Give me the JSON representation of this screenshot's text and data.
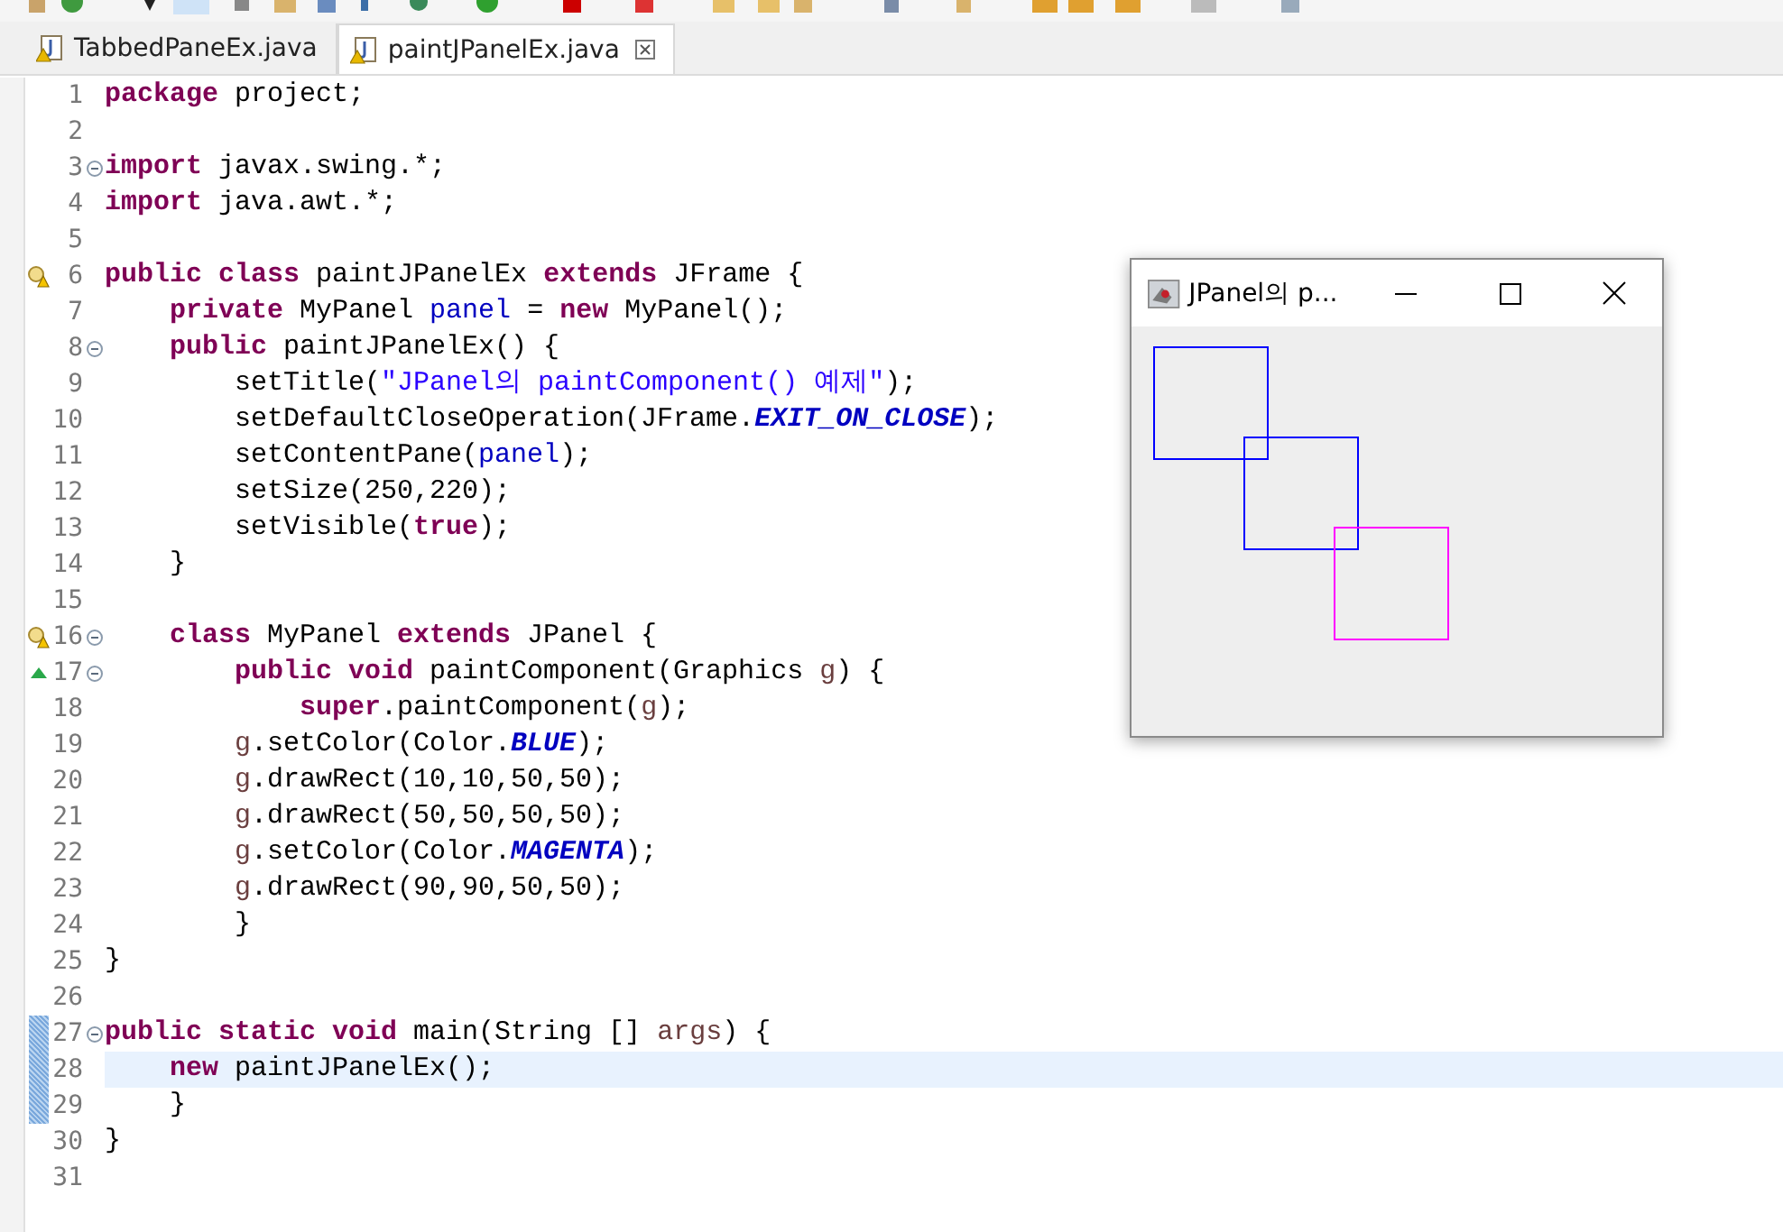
{
  "tabs": [
    {
      "label": "TabbedPaneEx.java",
      "selected": false
    },
    {
      "label": "paintJPanelEx.java",
      "selected": true
    }
  ],
  "editor": {
    "lines": [
      {
        "number": "1",
        "warning": false,
        "override": false,
        "fold": false,
        "changed": false,
        "current": false,
        "tokens": [
          {
            "kind": "kw",
            "text": "package"
          },
          {
            "kind": "plain",
            "text": " project;"
          }
        ]
      },
      {
        "number": "2",
        "warning": false,
        "override": false,
        "fold": false,
        "changed": false,
        "current": false
      },
      {
        "number": "3",
        "warning": false,
        "override": false,
        "fold": true,
        "changed": false,
        "current": false,
        "tokens": [
          {
            "kind": "kw",
            "text": "import"
          },
          {
            "kind": "plain",
            "text": " javax.swing.*;"
          }
        ]
      },
      {
        "number": "4",
        "warning": false,
        "override": false,
        "fold": false,
        "changed": false,
        "current": false,
        "tokens": [
          {
            "kind": "kw",
            "text": "import"
          },
          {
            "kind": "plain",
            "text": " java.awt.*;"
          }
        ]
      },
      {
        "number": "5",
        "warning": false,
        "override": false,
        "fold": false,
        "changed": false,
        "current": false
      },
      {
        "number": "6",
        "warning": true,
        "override": false,
        "fold": false,
        "changed": false,
        "current": false,
        "tokens": [
          {
            "kind": "kw",
            "text": "public class"
          },
          {
            "kind": "plain",
            "text": " paintJPanelEx "
          },
          {
            "kind": "kw",
            "text": "extends"
          },
          {
            "kind": "plain",
            "text": " JFrame {"
          }
        ]
      },
      {
        "number": "7",
        "warning": false,
        "override": false,
        "fold": false,
        "changed": false,
        "current": false,
        "tokens": [
          {
            "kind": "kw",
            "text": "    private"
          },
          {
            "kind": "plain",
            "text": " MyPanel "
          },
          {
            "kind": "field",
            "text": "panel"
          },
          {
            "kind": "plain",
            "text": " = "
          },
          {
            "kind": "kw",
            "text": "new"
          },
          {
            "kind": "plain",
            "text": " MyPanel();"
          }
        ]
      },
      {
        "number": "8",
        "warning": false,
        "override": false,
        "fold": true,
        "changed": false,
        "current": false,
        "tokens": [
          {
            "kind": "kw",
            "text": "    public"
          },
          {
            "kind": "plain",
            "text": " paintJPanelEx() {"
          }
        ]
      },
      {
        "number": "9",
        "warning": false,
        "override": false,
        "fold": false,
        "changed": false,
        "current": false,
        "tokens": [
          {
            "kind": "plain",
            "text": "        setTitle("
          },
          {
            "kind": "str",
            "text": "\"JPanel의 paintComponent() 예제\""
          },
          {
            "kind": "plain",
            "text": ");"
          }
        ]
      },
      {
        "number": "10",
        "warning": false,
        "override": false,
        "fold": false,
        "changed": false,
        "current": false,
        "tokens": [
          {
            "kind": "plain",
            "text": "        setDefaultCloseOperation(JFrame."
          },
          {
            "kind": "const",
            "text": "EXIT_ON_CLOSE"
          },
          {
            "kind": "plain",
            "text": ");"
          }
        ]
      },
      {
        "number": "11",
        "warning": false,
        "override": false,
        "fold": false,
        "changed": false,
        "current": false,
        "tokens": [
          {
            "kind": "plain",
            "text": "        setContentPane("
          },
          {
            "kind": "field",
            "text": "panel"
          },
          {
            "kind": "plain",
            "text": ");"
          }
        ]
      },
      {
        "number": "12",
        "warning": false,
        "override": false,
        "fold": false,
        "changed": false,
        "current": false,
        "tokens": [
          {
            "kind": "plain",
            "text": "        setSize(250,220);"
          }
        ]
      },
      {
        "number": "13",
        "warning": false,
        "override": false,
        "fold": false,
        "changed": false,
        "current": false,
        "tokens": [
          {
            "kind": "plain",
            "text": "        setVisible("
          },
          {
            "kind": "kw",
            "text": "true"
          },
          {
            "kind": "plain",
            "text": ");"
          }
        ]
      },
      {
        "number": "14",
        "warning": false,
        "override": false,
        "fold": false,
        "changed": false,
        "current": false,
        "tokens": [
          {
            "kind": "plain",
            "text": "    }"
          }
        ]
      },
      {
        "number": "15",
        "warning": false,
        "override": false,
        "fold": false,
        "changed": false,
        "current": false
      },
      {
        "number": "16",
        "warning": true,
        "override": false,
        "fold": true,
        "changed": false,
        "current": false,
        "tokens": [
          {
            "kind": "kw",
            "text": "    class"
          },
          {
            "kind": "plain",
            "text": " MyPanel "
          },
          {
            "kind": "kw",
            "text": "extends"
          },
          {
            "kind": "plain",
            "text": " JPanel {"
          }
        ]
      },
      {
        "number": "17",
        "warning": false,
        "override": true,
        "fold": true,
        "changed": false,
        "current": false,
        "tokens": [
          {
            "kind": "kw",
            "text": "        public void"
          },
          {
            "kind": "plain",
            "text": " paintComponent(Graphics "
          },
          {
            "kind": "param",
            "text": "g"
          },
          {
            "kind": "plain",
            "text": ") {"
          }
        ]
      },
      {
        "number": "18",
        "warning": false,
        "override": false,
        "fold": false,
        "changed": false,
        "current": false,
        "tokens": [
          {
            "kind": "kw",
            "text": "            super"
          },
          {
            "kind": "plain",
            "text": ".paintComponent("
          },
          {
            "kind": "param",
            "text": "g"
          },
          {
            "kind": "plain",
            "text": ");"
          }
        ]
      },
      {
        "number": "19",
        "warning": false,
        "override": false,
        "fold": false,
        "changed": false,
        "current": false,
        "tokens": [
          {
            "kind": "param",
            "text": "        g"
          },
          {
            "kind": "plain",
            "text": ".setColor(Color."
          },
          {
            "kind": "const",
            "text": "BLUE"
          },
          {
            "kind": "plain",
            "text": ");"
          }
        ]
      },
      {
        "number": "20",
        "warning": false,
        "override": false,
        "fold": false,
        "changed": false,
        "current": false,
        "tokens": [
          {
            "kind": "param",
            "text": "        g"
          },
          {
            "kind": "plain",
            "text": ".drawRect(10,10,50,50);"
          }
        ]
      },
      {
        "number": "21",
        "warning": false,
        "override": false,
        "fold": false,
        "changed": false,
        "current": false,
        "tokens": [
          {
            "kind": "param",
            "text": "        g"
          },
          {
            "kind": "plain",
            "text": ".drawRect(50,50,50,50);"
          }
        ]
      },
      {
        "number": "22",
        "warning": false,
        "override": false,
        "fold": false,
        "changed": false,
        "current": false,
        "tokens": [
          {
            "kind": "param",
            "text": "        g"
          },
          {
            "kind": "plain",
            "text": ".setColor(Color."
          },
          {
            "kind": "const",
            "text": "MAGENTA"
          },
          {
            "kind": "plain",
            "text": ");"
          }
        ]
      },
      {
        "number": "23",
        "warning": false,
        "override": false,
        "fold": false,
        "changed": false,
        "current": false,
        "tokens": [
          {
            "kind": "param",
            "text": "        g"
          },
          {
            "kind": "plain",
            "text": ".drawRect(90,90,50,50);"
          }
        ]
      },
      {
        "number": "24",
        "warning": false,
        "override": false,
        "fold": false,
        "changed": false,
        "current": false,
        "tokens": [
          {
            "kind": "plain",
            "text": "        }"
          }
        ]
      },
      {
        "number": "25",
        "warning": false,
        "override": false,
        "fold": false,
        "changed": false,
        "current": false,
        "tokens": [
          {
            "kind": "plain",
            "text": "}"
          }
        ]
      },
      {
        "number": "26",
        "warning": false,
        "override": false,
        "fold": false,
        "changed": false,
        "current": false
      },
      {
        "number": "27",
        "warning": false,
        "override": false,
        "fold": true,
        "changed": true,
        "current": false,
        "tokens": [
          {
            "kind": "kw",
            "text": "public static void"
          },
          {
            "kind": "plain",
            "text": " main(String [] "
          },
          {
            "kind": "param",
            "text": "args"
          },
          {
            "kind": "plain",
            "text": ") {"
          }
        ]
      },
      {
        "number": "28",
        "warning": false,
        "override": false,
        "fold": false,
        "changed": true,
        "current": true,
        "tokens": [
          {
            "kind": "kw",
            "text": "    new"
          },
          {
            "kind": "plain",
            "text": " paintJPanelEx();"
          }
        ]
      },
      {
        "number": "29",
        "warning": false,
        "override": false,
        "fold": false,
        "changed": true,
        "current": false,
        "tokens": [
          {
            "kind": "plain",
            "text": "    }"
          }
        ]
      },
      {
        "number": "30",
        "warning": false,
        "override": false,
        "fold": false,
        "changed": false,
        "current": false,
        "tokens": [
          {
            "kind": "plain",
            "text": "}"
          }
        ]
      },
      {
        "number": "31",
        "warning": false,
        "override": false,
        "fold": false,
        "changed": false,
        "current": false
      }
    ]
  },
  "frame": {
    "title": "JPanel의 p...",
    "rects": [
      {
        "color": "#0000ff"
      },
      {
        "color": "#0000ff"
      },
      {
        "color": "#ff00ff"
      }
    ]
  }
}
